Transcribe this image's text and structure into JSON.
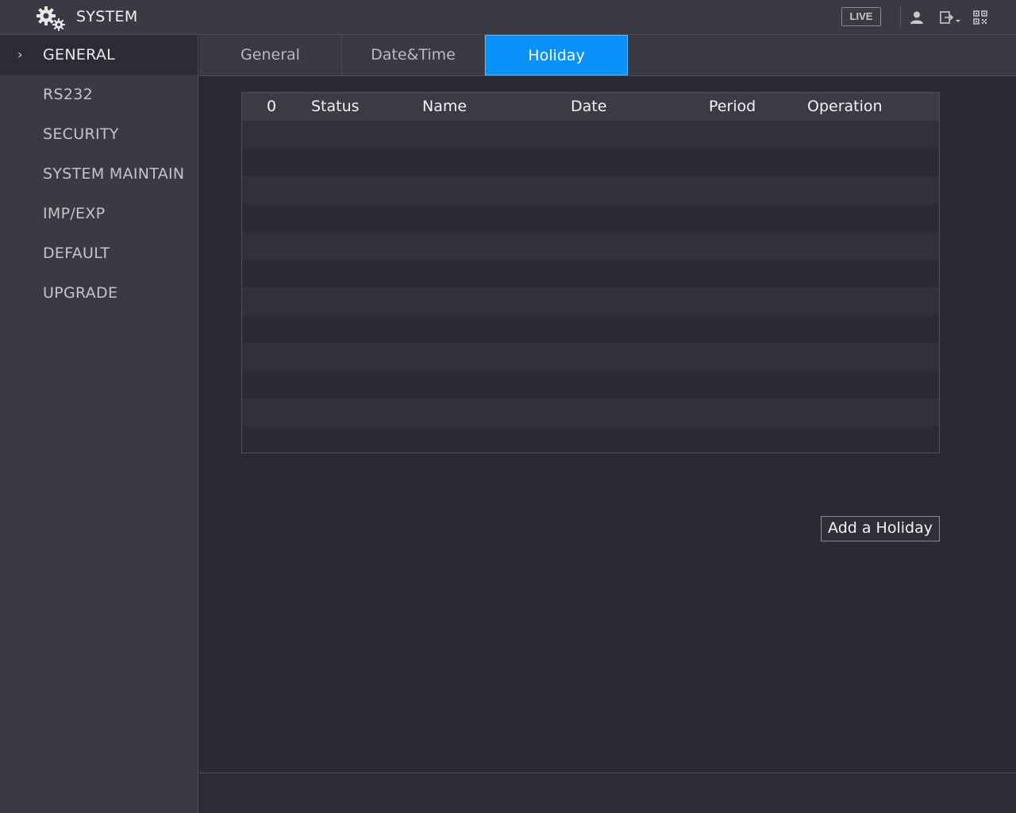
{
  "header": {
    "title": "SYSTEM",
    "live_label": "LIVE",
    "icons": [
      "settings-gear-icon",
      "user-icon",
      "logout-icon",
      "qr-code-icon"
    ]
  },
  "sidebar": {
    "items": [
      {
        "label": "GENERAL",
        "active": true
      },
      {
        "label": "RS232"
      },
      {
        "label": "SECURITY"
      },
      {
        "label": "SYSTEM MAINTAIN"
      },
      {
        "label": "IMP/EXP"
      },
      {
        "label": "DEFAULT"
      },
      {
        "label": "UPGRADE"
      }
    ]
  },
  "tabs": [
    {
      "label": "General"
    },
    {
      "label": "Date&Time"
    },
    {
      "label": "Holiday",
      "active": true
    }
  ],
  "table": {
    "columns": [
      "0",
      "Status",
      "Name",
      "Date",
      "Period",
      "Operation"
    ],
    "rows": []
  },
  "actions": {
    "add_holiday": "Add a Holiday"
  },
  "colors": {
    "accent": "#0891f8",
    "background": "#292a35",
    "panel": "#393a44"
  }
}
